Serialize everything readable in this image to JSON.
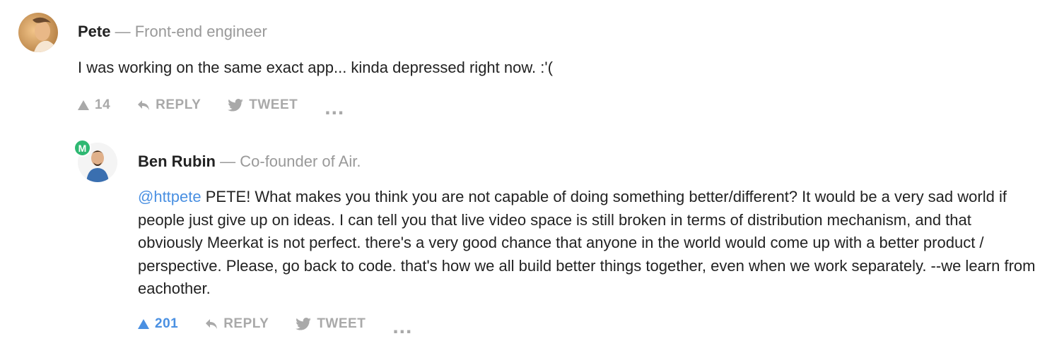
{
  "comments": [
    {
      "author": "Pete",
      "separator": "—",
      "headline": "Front-end engineer",
      "text": "I was working on the same exact app... kinda depressed right now. :'(",
      "votes": "14",
      "reply_label": "REPLY",
      "tweet_label": "TWEET",
      "more_label": "..."
    },
    {
      "author": "Ben Rubin",
      "separator": "—",
      "headline": "Co-founder of Air.",
      "badge": "M",
      "mention": "@httpete",
      "text": " PETE! What makes you think you are not capable of doing something better/different? It would be a very sad world if people just give up on ideas. I can tell you that live video space is still broken in terms of distribution mechanism, and that obviously Meerkat is not perfect. there's a very good chance that anyone in the world would come up with a better product / perspective. Please, go back to code. that's how we all build better things together, even when we work separately. --we learn from eachother.",
      "votes": "201",
      "reply_label": "REPLY",
      "tweet_label": "TWEET",
      "more_label": "..."
    }
  ],
  "colors": {
    "accent": "#4a90e2",
    "muted": "#a9a9a9",
    "badge": "#2eb872"
  }
}
